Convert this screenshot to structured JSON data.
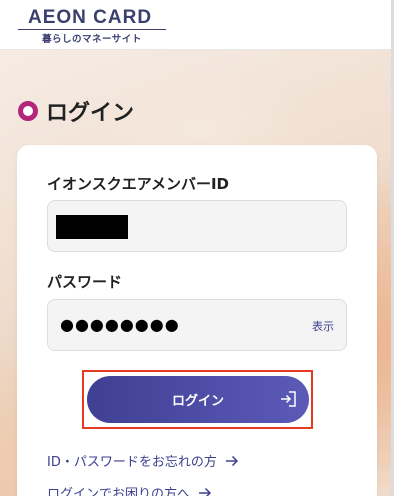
{
  "header": {
    "logo_main": "AEON CARD",
    "logo_sub": "暮らしのマネーサイト"
  },
  "page": {
    "title": "ログイン"
  },
  "form": {
    "member_id_label": "イオンスクエアメンバーID",
    "member_id_value": "",
    "password_label": "パスワード",
    "password_value": "●●●●●●●●",
    "show_password_label": "表示",
    "login_button_label": "ログイン"
  },
  "links": {
    "forgot_id_password": "ID・パスワードをお忘れの方",
    "login_trouble": "ログインでお困りの方へ"
  },
  "colors": {
    "accent": "#3d3f8f",
    "brand_ring": "#b3267a",
    "highlight_outline": "#e53a1f"
  }
}
